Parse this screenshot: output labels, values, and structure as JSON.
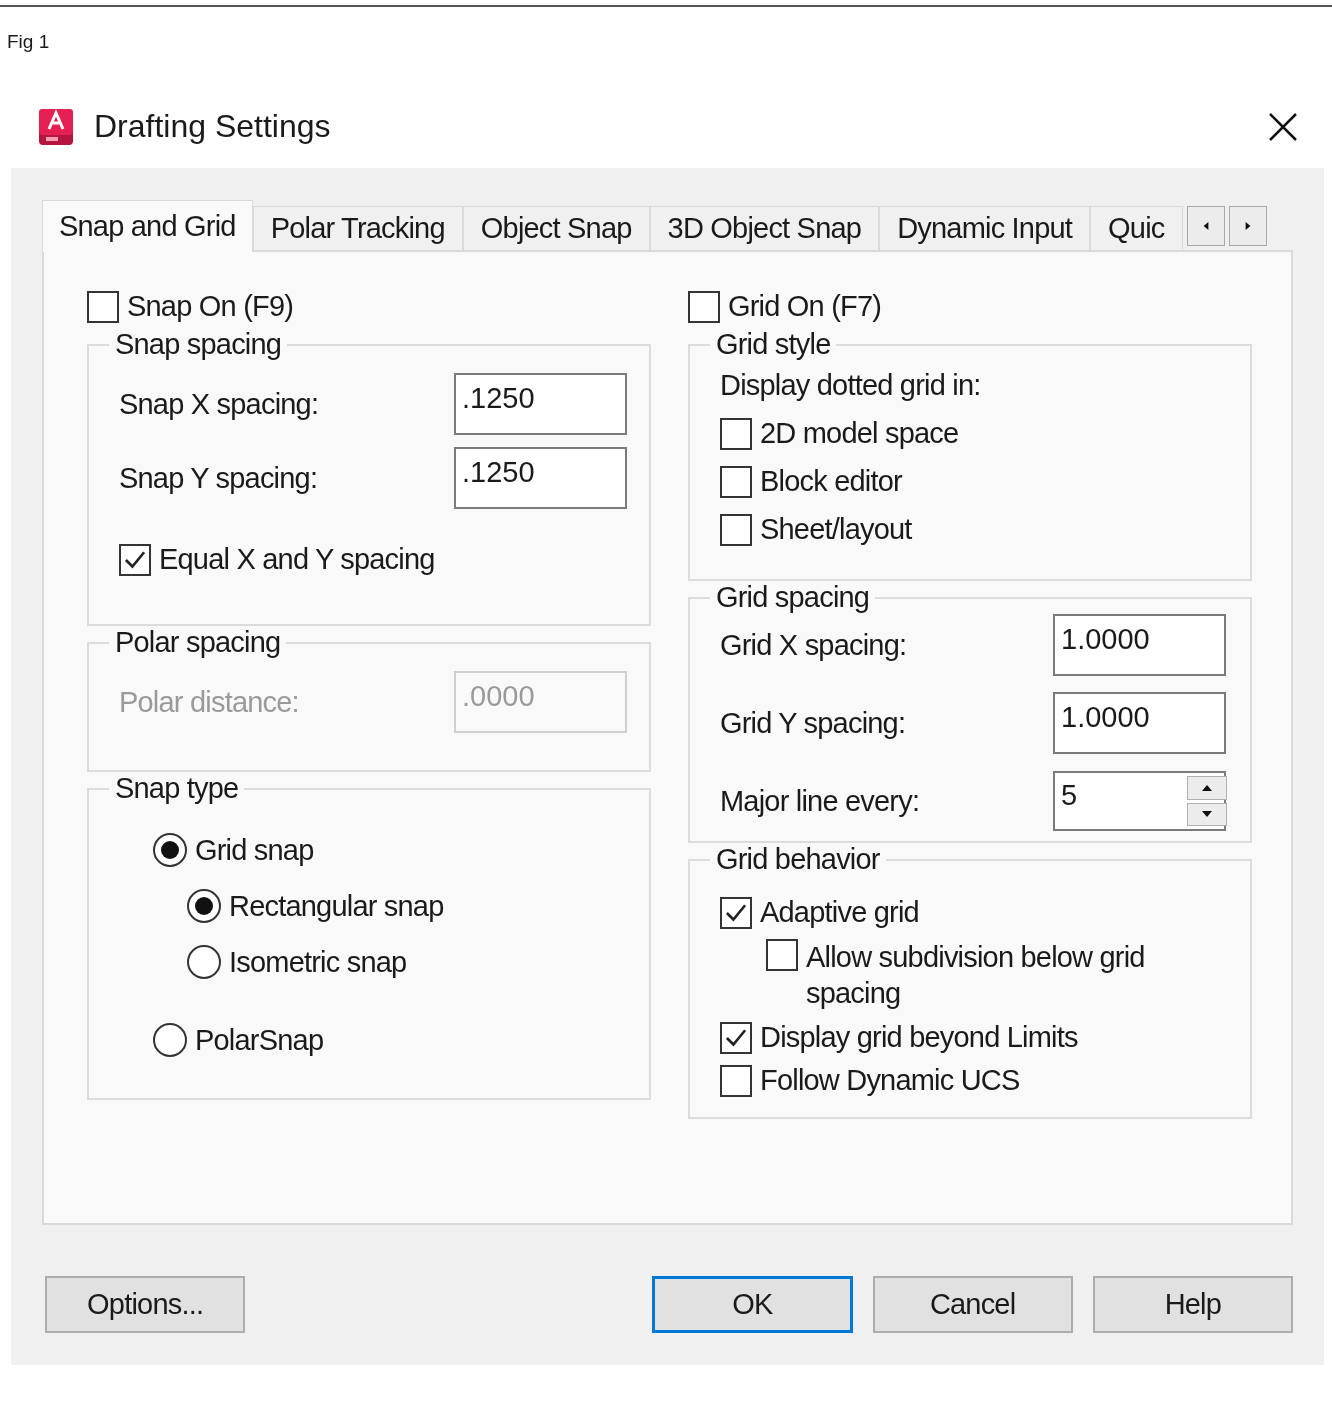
{
  "figure_label": "Fig 1",
  "window": {
    "title": "Drafting Settings"
  },
  "tabs": [
    {
      "label": "Snap and Grid",
      "selected": true
    },
    {
      "label": "Polar Tracking",
      "selected": false
    },
    {
      "label": "Object Snap",
      "selected": false
    },
    {
      "label": "3D Object Snap",
      "selected": false
    },
    {
      "label": "Dynamic Input",
      "selected": false
    },
    {
      "label": "Quic",
      "selected": false
    }
  ],
  "snap_on": {
    "label": "Snap On (F9)",
    "checked": false
  },
  "snap_spacing": {
    "title": "Snap spacing",
    "fields": [
      {
        "label": "Snap X spacing:",
        "value": ".1250",
        "disabled": false
      },
      {
        "label": "Snap Y spacing:",
        "value": ".1250",
        "disabled": false
      }
    ],
    "equal": {
      "label": "Equal X and Y spacing",
      "checked": true
    }
  },
  "polar_spacing": {
    "title": "Polar spacing",
    "fields": [
      {
        "label": "Polar distance:",
        "value": ".0000",
        "disabled": true
      }
    ]
  },
  "snap_type": {
    "title": "Snap type",
    "options": [
      {
        "label": "Grid snap",
        "selected": true,
        "children": [
          {
            "label": "Rectangular snap",
            "selected": true
          },
          {
            "label": "Isometric snap",
            "selected": false
          }
        ]
      },
      {
        "label": "PolarSnap",
        "selected": false
      }
    ]
  },
  "grid_on": {
    "label": "Grid On (F7)",
    "checked": false
  },
  "grid_style": {
    "title": "Grid style",
    "caption": "Display dotted grid in:",
    "options": [
      {
        "label": "2D model space",
        "checked": false
      },
      {
        "label": "Block editor",
        "checked": false
      },
      {
        "label": "Sheet/layout",
        "checked": false
      }
    ]
  },
  "grid_spacing": {
    "title": "Grid spacing",
    "fields": [
      {
        "label": "Grid X spacing:",
        "value": "1.0000",
        "kind": "text"
      },
      {
        "label": "Grid Y spacing:",
        "value": "1.0000",
        "kind": "text"
      },
      {
        "label": "Major line every:",
        "value": "5",
        "kind": "spinner"
      }
    ]
  },
  "grid_behavior": {
    "title": "Grid behavior",
    "options": [
      {
        "label": "Adaptive grid",
        "checked": true,
        "children": [
          {
            "label": "Allow subdivision below grid spacing",
            "checked": false
          }
        ]
      },
      {
        "label": "Display grid beyond Limits",
        "checked": true
      },
      {
        "label": "Follow Dynamic UCS",
        "checked": false
      }
    ]
  },
  "buttons": [
    {
      "label": "Options...",
      "default": false
    },
    {
      "label": "OK",
      "default": true
    },
    {
      "label": "Cancel",
      "default": false
    },
    {
      "label": "Help",
      "default": false
    }
  ]
}
